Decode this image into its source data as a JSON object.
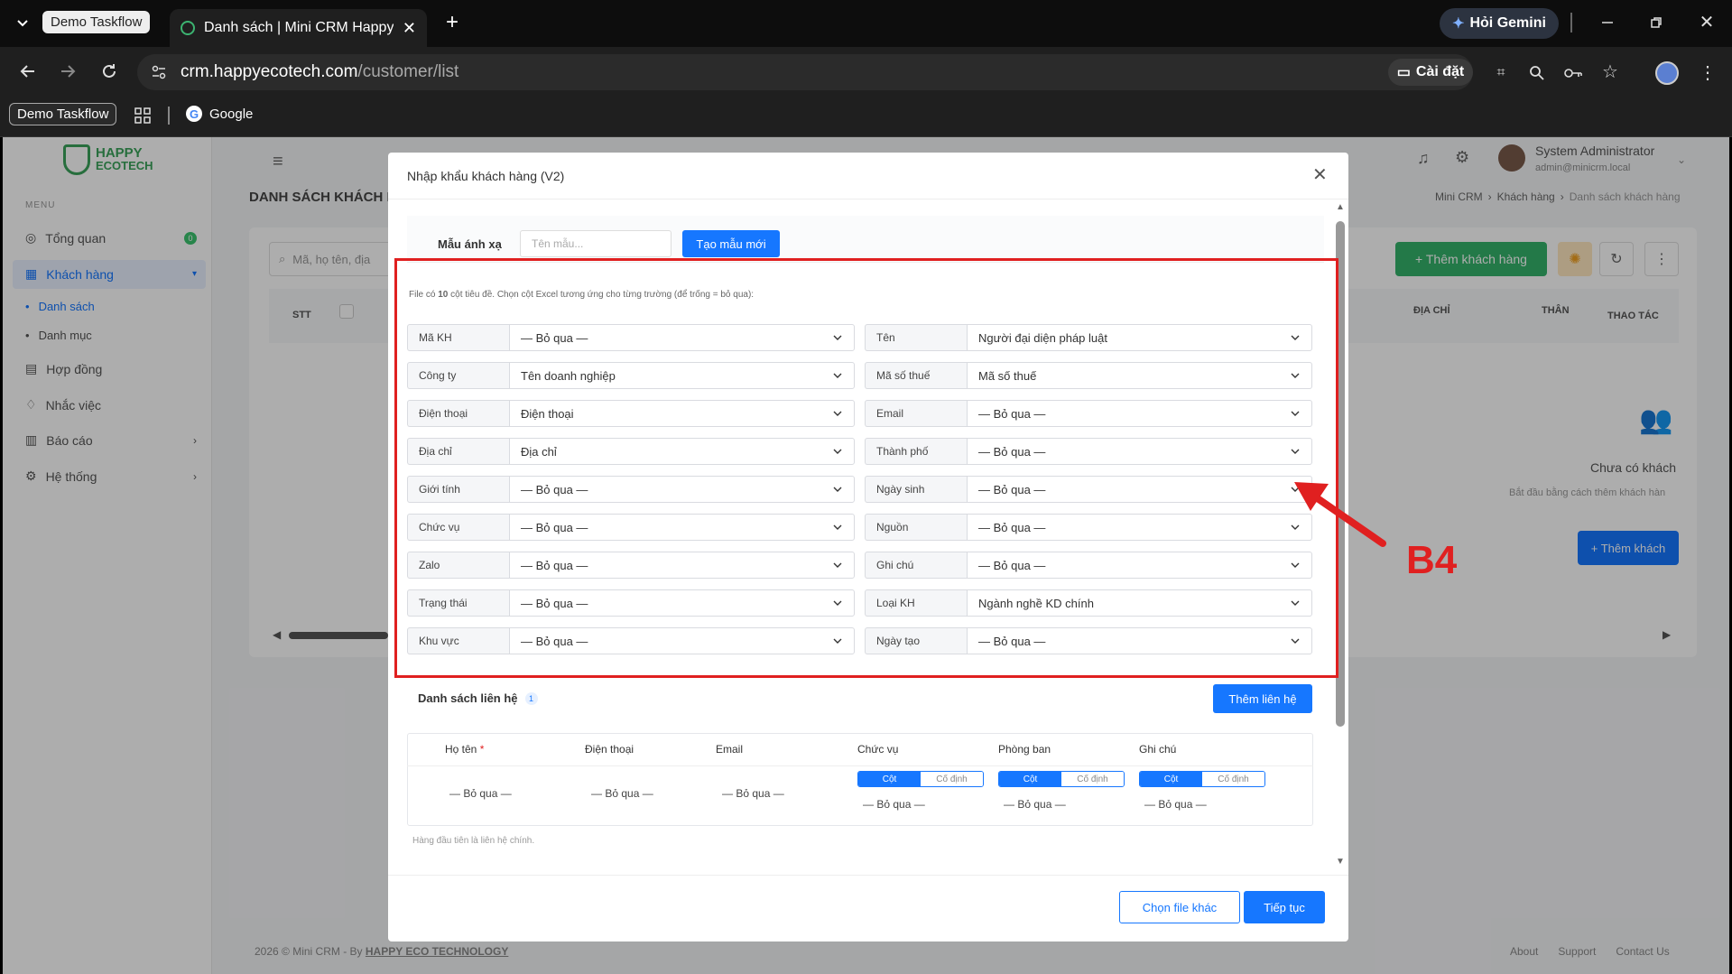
{
  "browser": {
    "profile_chip": "Demo Taskflow",
    "tab_title": "Danh sách | Mini CRM Happy Ec",
    "gemini_label": "Hỏi Gemini",
    "url_host": "crm.happyecotech.com",
    "url_path": "/customer/list",
    "install_label": "Cài đặt",
    "bookmark_profile": "Demo Taskflow",
    "bookmark_google": "Google"
  },
  "app": {
    "logo_line1": "HAPPY",
    "logo_line2": "ECOTECH",
    "menu_heading": "MENU",
    "menu": [
      {
        "label": "Tổng quan",
        "badge": "0"
      },
      {
        "label": "Khách hàng"
      },
      {
        "label": "Danh sách"
      },
      {
        "label": "Danh mục"
      },
      {
        "label": "Hợp đồng"
      },
      {
        "label": "Nhắc việc"
      },
      {
        "label": "Báo cáo"
      },
      {
        "label": "Hệ thống"
      }
    ],
    "page_title": "DANH SÁCH KHÁCH H",
    "breadcrumb": [
      "Mini CRM",
      "Khách hàng",
      "Danh sách khách hàng"
    ],
    "user_name": "System Administrator",
    "user_email": "admin@minicrm.local",
    "search_placeholder": "Mã, họ tên, địa",
    "add_customer": "+ Thêm khách hàng",
    "col_stt": "STT",
    "col_address": "ĐỊA CHỈ",
    "col_than": "THÂN",
    "col_actions": "THAO TÁC",
    "empty_title": "Chưa có khách",
    "empty_sub": "Bắt đầu bằng cách thêm khách hàn",
    "empty_button": "+ Thêm khách",
    "footer_left": "2026 © Mini CRM - By ",
    "footer_company": "HAPPY ECO TECHNOLOGY",
    "footer_links": [
      "About",
      "Support",
      "Contact Us"
    ]
  },
  "modal": {
    "title": "Nhập khẩu khách hàng (V2)",
    "template_label": "Mẫu ánh xạ",
    "template_placeholder": "Tên mẫu...",
    "template_button": "Tạo mẫu mới",
    "hint_prefix": "File có ",
    "hint_count": "10",
    "hint_suffix": " cột tiêu đề. Chọn cột Excel tương ứng cho từng trường (để trống = bỏ qua):",
    "fields_left": [
      {
        "label": "Mã KH",
        "value": "— Bỏ qua —"
      },
      {
        "label": "Công ty",
        "value": "Tên doanh nghiệp"
      },
      {
        "label": "Điện thoại",
        "value": "Điện thoại"
      },
      {
        "label": "Địa chỉ",
        "value": "Địa chỉ"
      },
      {
        "label": "Giới tính",
        "value": "— Bỏ qua —"
      },
      {
        "label": "Chức vụ",
        "value": "— Bỏ qua —"
      },
      {
        "label": "Zalo",
        "value": "— Bỏ qua —"
      },
      {
        "label": "Trạng thái",
        "value": "— Bỏ qua —"
      },
      {
        "label": "Khu vực",
        "value": "— Bỏ qua —"
      }
    ],
    "fields_right": [
      {
        "label": "Tên",
        "value": "Người đại diện pháp luật"
      },
      {
        "label": "Mã số thuế",
        "value": "Mã số thuế"
      },
      {
        "label": "Email",
        "value": "— Bỏ qua —"
      },
      {
        "label": "Thành phố",
        "value": "— Bỏ qua —"
      },
      {
        "label": "Ngày sinh",
        "value": "— Bỏ qua —"
      },
      {
        "label": "Nguồn",
        "value": "— Bỏ qua —"
      },
      {
        "label": "Ghi chú",
        "value": "— Bỏ qua —"
      },
      {
        "label": "Loại KH",
        "value": "Ngành nghề KD chính"
      },
      {
        "label": "Ngày tạo",
        "value": "— Bỏ qua —"
      }
    ],
    "contacts_title": "Danh sách liên hệ",
    "contacts_badge": "1",
    "add_contact": "Thêm liên hệ",
    "contact_cols": [
      "Họ tên",
      "Điện thoại",
      "Email",
      "Chức vụ",
      "Phòng ban",
      "Ghi chú"
    ],
    "required_mark": "*",
    "skip_text": "— Bỏ qua —",
    "seg_on": "Cột",
    "seg_off": "Cố định",
    "contacts_hint": "Hàng đầu tiên là liên hệ chính.",
    "btn_other_file": "Chọn file khác",
    "btn_continue": "Tiếp tục"
  },
  "annotation": {
    "label": "B4",
    "color": "#e02020"
  }
}
